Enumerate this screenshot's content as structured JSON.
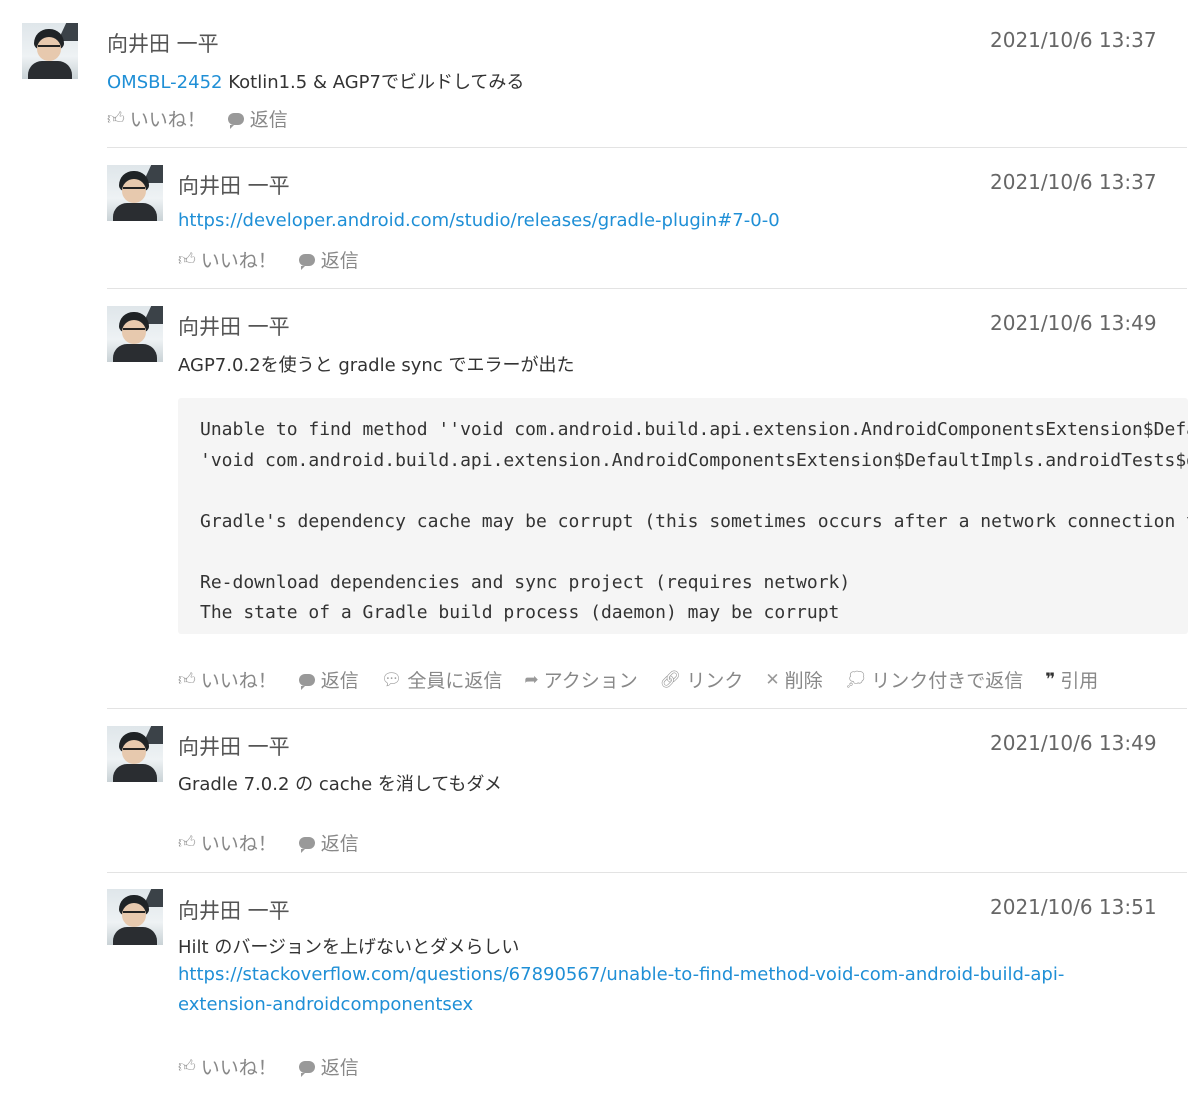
{
  "comments": [
    {
      "author": "向井田 一平",
      "time": "2021/10/6 13:37",
      "ticket_link": "OMSBL-2452",
      "text": " Kotlin1.5 & AGP7でビルドしてみる",
      "actions": {
        "like": "いいね！",
        "reply": "返信"
      }
    },
    {
      "author": "向井田 一平",
      "time": "2021/10/6 13:37",
      "link": "https://developer.android.com/studio/releases/gradle-plugin#7-0-0",
      "actions": {
        "like": "いいね！",
        "reply": "返信"
      }
    },
    {
      "author": "向井田 一平",
      "time": "2021/10/6 13:49",
      "text": "AGP7.0.2を使うと gradle sync でエラーが出た",
      "code": "Unable to find method ''void com.android.build.api.extension.AndroidComponentsExtension$DefaultImpls.androidTests$default(\n'void com.android.build.api.extension.AndroidComponentsExtension$DefaultImpls.androidTests$default(\n\nGradle's dependency cache may be corrupt (this sometimes occurs after a network connection timeout.)\n\nRe-download dependencies and sync project (requires network)\nThe state of a Gradle build process (daemon) may be corrupt",
      "actions": {
        "like": "いいね！",
        "reply": "返信",
        "reply_all": "全員に返信",
        "action": "アクション",
        "link": "リンク",
        "delete": "削除",
        "reply_with_link": "リンク付きで返信",
        "quote": "引用"
      }
    },
    {
      "author": "向井田 一平",
      "time": "2021/10/6 13:49",
      "text": "Gradle 7.0.2 の cache を消してもダメ",
      "actions": {
        "like": "いいね！",
        "reply": "返信"
      }
    },
    {
      "author": "向井田 一平",
      "time": "2021/10/6 13:51",
      "text": "Hilt のバージョンを上げないとダメらしい",
      "link_line1": "https://stackoverflow.com/questions/67890567/unable-to-find-method-void-com-android-build-api-",
      "link_line2": "extension-androidcomponentsex",
      "actions": {
        "like": "いいね！",
        "reply": "返信"
      }
    }
  ],
  "icons": {
    "like": "thumbs-up-icon",
    "reply": "speech-bubble-icon",
    "reply_all": "speech-bubbles-icon",
    "action": "arrow-icon",
    "link": "link-icon",
    "delete": "close-icon",
    "reply_with_link": "comment-dots-icon",
    "quote": "quote-icon"
  },
  "colors": {
    "link": "#1f8fd6",
    "muted": "#888888",
    "code_bg": "#f5f5f5"
  }
}
